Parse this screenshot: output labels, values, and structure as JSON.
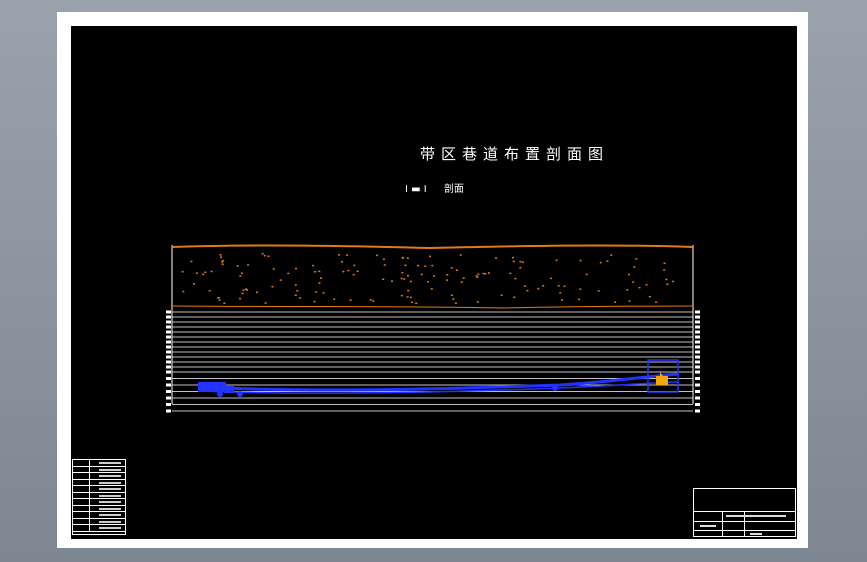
{
  "drawing": {
    "title": "带区巷道布置剖面图",
    "section_mark": "I ▬ I",
    "section_label": "剖面"
  },
  "colors": {
    "background": "#000000",
    "line": "#ffffff",
    "surface": "#e07b1a",
    "roadway": "#2233ff",
    "equipment": "#f2a800"
  },
  "legend": {
    "row_count": 11
  },
  "profile": {
    "stratum_lines": 19
  }
}
